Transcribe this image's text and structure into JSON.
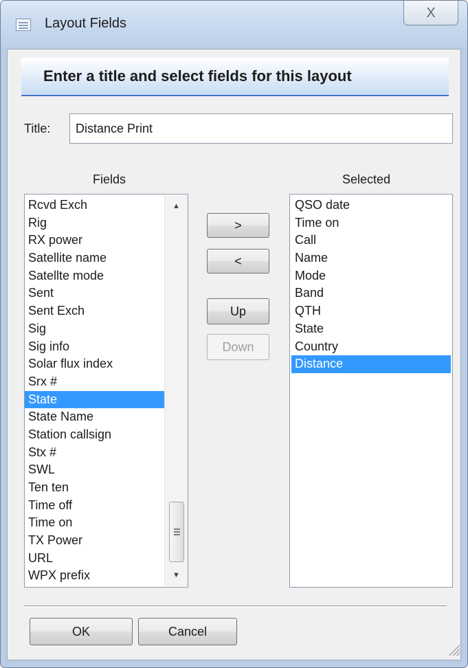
{
  "window": {
    "title": "Layout Fields",
    "close_glyph": "X"
  },
  "banner": {
    "text": "Enter a title and select fields for this layout"
  },
  "title_field": {
    "label": "Title:",
    "value": "Distance Print"
  },
  "fields": {
    "header": "Fields",
    "items": [
      "Rcvd Exch",
      "Rig",
      "RX power",
      "Satellite name",
      "Satellte mode",
      "Sent",
      "Sent Exch",
      "Sig",
      "Sig info",
      "Solar flux index",
      "Srx #",
      "State",
      "State Name",
      "Station callsign",
      "Stx #",
      "SWL",
      "Ten ten",
      "Time off",
      "Time on",
      "TX Power",
      "URL",
      "WPX prefix"
    ],
    "selected_index": 11
  },
  "selected": {
    "header": "Selected",
    "items": [
      "QSO date",
      "Time on",
      "Call",
      "Name",
      "Mode",
      "Band",
      "QTH",
      "State",
      "Country",
      "Distance"
    ],
    "selected_index": 9
  },
  "buttons": {
    "add": ">",
    "remove": "<",
    "up": "Up",
    "down": "Down",
    "ok": "OK",
    "cancel": "Cancel"
  },
  "icons": {
    "window": "window-icon",
    "close": "close-icon",
    "scroll_up": "scroll-up-arrow-icon",
    "scroll_down": "scroll-down-arrow-icon",
    "resize": "resize-grip-icon"
  },
  "colors": {
    "selection": "#3399ff",
    "banner_rule": "#3f73c8"
  }
}
